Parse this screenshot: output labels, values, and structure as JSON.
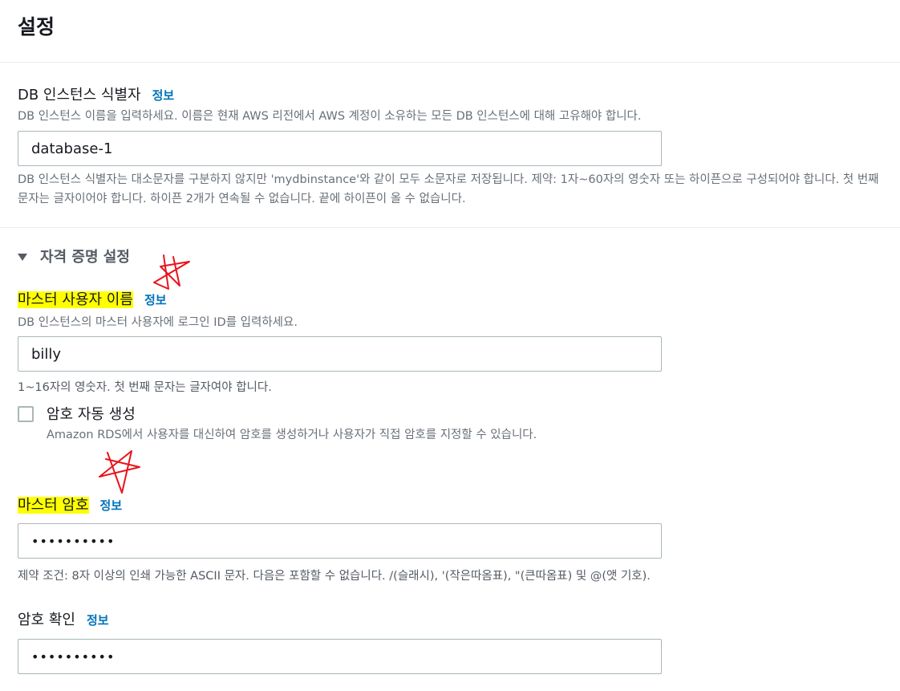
{
  "header": {
    "title": "설정"
  },
  "instance_id": {
    "label": "DB 인스턴스 식별자",
    "info": "정보",
    "description": "DB 인스턴스 이름을 입력하세요. 이름은 현재 AWS 리전에서 AWS 계정이 소유하는 모든 DB 인스턴스에 대해 고유해야 합니다.",
    "value": "database-1",
    "constraint": "DB 인스턴스 식별자는 대소문자를 구분하지 않지만 'mydbinstance'와 같이 모두 소문자로 저장됩니다. 제약: 1자~60자의 영숫자 또는 하이픈으로 구성되어야 합니다. 첫 번째 문자는 글자이어야 합니다. 하이픈 2개가 연속될 수 없습니다. 끝에 하이픈이 올 수 없습니다."
  },
  "credentials": {
    "section_title": "자격 증명 설정",
    "master_username": {
      "label": "마스터 사용자 이름",
      "info": "정보",
      "description": "DB 인스턴스의 마스터 사용자에 로그인 ID를 입력하세요.",
      "value": "billy",
      "constraint": "1~16자의 영숫자. 첫 번째 문자는 글자여야 합니다."
    },
    "auto_password": {
      "label": "암호 자동 생성",
      "checked": false,
      "description": "Amazon RDS에서 사용자를 대신하여 암호를 생성하거나 사용자가 직접 암호를 지정할 수 있습니다."
    },
    "master_password": {
      "label": "마스터 암호",
      "info": "정보",
      "value": "••••••••••",
      "constraint": "제약 조건: 8자 이상의 인쇄 가능한 ASCII 문자. 다음은 포함할 수 없습니다. /(슬래시), '(작은따옴표), \"(큰따옴표) 및 @(앳 기호)."
    },
    "confirm_password": {
      "label": "암호 확인",
      "info": "정보",
      "value": "••••••••••"
    }
  },
  "annotations": {
    "highlight_color": "#ffff00",
    "star_color": "#e8141c"
  }
}
